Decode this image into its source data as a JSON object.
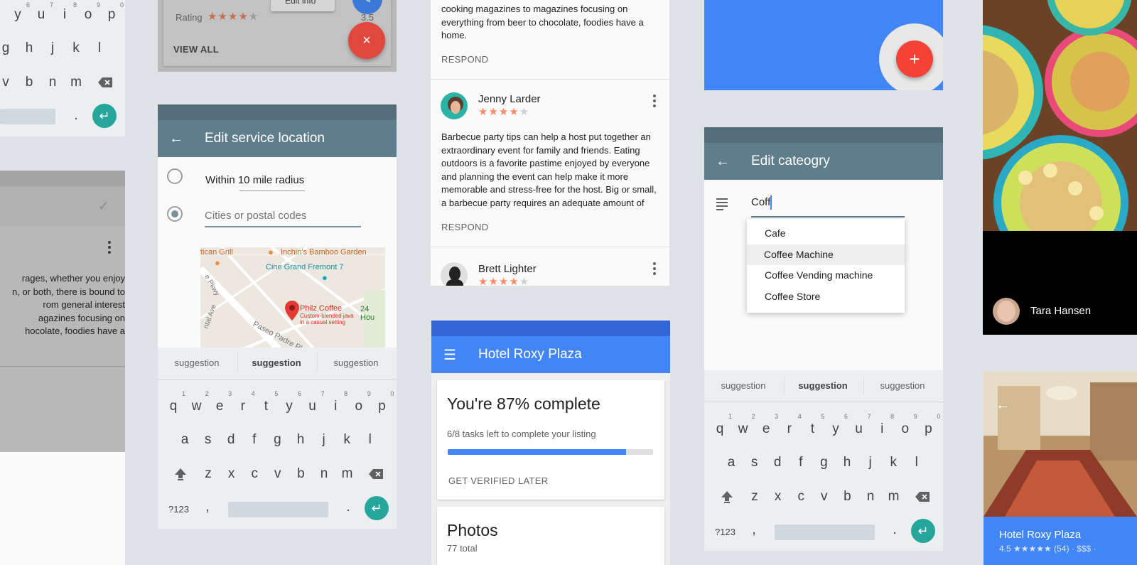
{
  "colors": {
    "accent": "#4285f4",
    "teal": "#26a69a",
    "fab_red": "#f44336",
    "toolbar_slate": "#607d8b"
  },
  "keyboard": {
    "row1": [
      {
        "k": "q",
        "n": "1"
      },
      {
        "k": "w",
        "n": "2"
      },
      {
        "k": "e",
        "n": "3"
      },
      {
        "k": "r",
        "n": "4"
      },
      {
        "k": "t",
        "n": "5"
      },
      {
        "k": "y",
        "n": "6"
      },
      {
        "k": "u",
        "n": "7"
      },
      {
        "k": "i",
        "n": "8"
      },
      {
        "k": "o",
        "n": "9"
      },
      {
        "k": "p",
        "n": "0"
      }
    ],
    "row2": [
      "a",
      "s",
      "d",
      "f",
      "g",
      "h",
      "j",
      "k",
      "l"
    ],
    "row3": [
      "z",
      "x",
      "c",
      "v",
      "b",
      "n",
      "m"
    ],
    "symbols": "?123",
    "comma": ",",
    "period": ".",
    "suggestions": [
      "suggestion",
      "suggestion",
      "suggestion"
    ]
  },
  "left_keyboard": {
    "row1": [
      {
        "k": "y",
        "n": "6"
      },
      {
        "k": "u",
        "n": "7"
      },
      {
        "k": "i",
        "n": "8"
      },
      {
        "k": "o",
        "n": "9"
      },
      {
        "k": "p",
        "n": "0"
      }
    ],
    "row2": [
      "g",
      "h",
      "j",
      "k",
      "l"
    ],
    "row3": [
      "v",
      "b",
      "n",
      "m"
    ],
    "period": "."
  },
  "left_review": {
    "text": "rages, whether you enjoy\nn, or both, there is bound to\nrom general interest\nagazines focusing on\nhocolate, foodies have a"
  },
  "rating_card": {
    "label": "Rating",
    "stars": "★★★★",
    "star_off": "★",
    "value": "3.5",
    "view_all": "VIEW ALL",
    "edit_info": "Edit info"
  },
  "service_location": {
    "title": "Edit service location",
    "option1": "Within 10 mile radius",
    "option2_placeholder": "Cities or postal codes",
    "map": {
      "place1": "tican Grill",
      "place2": "Inchin's Bamboo Garden",
      "place3": "Cine Grand Fremont 7",
      "place4": "Philz Coffee",
      "place4_sub1": "Custom-blended java",
      "place4_sub2": "in a casual setting",
      "place5": "24 Hou",
      "street1": "e Pkwy",
      "street2": "Paseo Padre Pk",
      "street3": "ntal Ave"
    }
  },
  "reviews": {
    "top_text": "cooking magazines to magazines focusing on\neverything from beer to chocolate, foodies have a\nhome.",
    "respond": "RESPOND",
    "items": [
      {
        "name": "Jenny Larder",
        "stars": "★★★★",
        "star_off": "★",
        "text": "Barbecue party tips can help a host put together an\nextraordinary event for family and friends. Eating\noutdoors is a favorite pastime enjoyed by everyone\nand planning the event can help make it more\nmemorable and stress-free for the host. Big or small,\na barbecue party requires an adequate amount of"
      },
      {
        "name": "Brett Lighter",
        "stars": "★★★★",
        "star_off": "★"
      }
    ]
  },
  "hotel": {
    "title": "Hotel Roxy Plaza",
    "progress_title": "You're 87% complete",
    "progress_sub": "6/8 tasks left to complete your listing",
    "progress_value": 0.87,
    "get_verified": "GET VERIFIED",
    "later": "LATER",
    "photos_title": "Photos",
    "photos_count": "77 total"
  },
  "category": {
    "title": "Edit cateogry",
    "input_value": "Coff",
    "options": [
      "Cafe",
      "Coffee Machine",
      "Coffee Vending machine",
      "Coffee Store"
    ],
    "highlighted_index": 1
  },
  "profile": {
    "name": "Tara Hansen"
  },
  "hotel_card": {
    "title": "Hotel Roxy Plaza",
    "meta": "4.5 ★★★★★ (54) · $$$ · "
  }
}
